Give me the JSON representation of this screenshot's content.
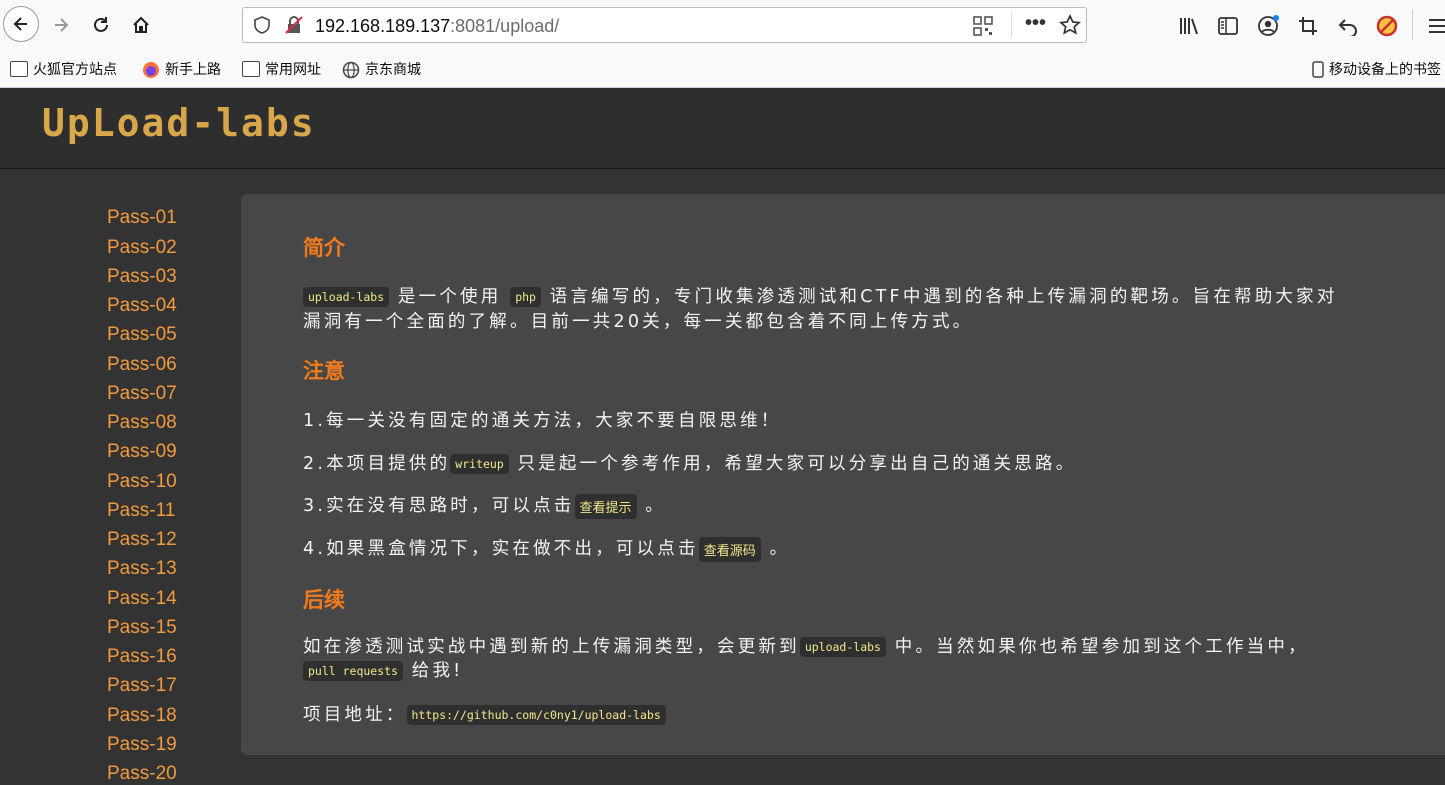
{
  "browser": {
    "url_host": "192.168.189.137",
    "url_rest": ":8081/upload/",
    "bookmarks": [
      "火狐官方站点",
      "新手上路",
      "常用网址",
      "京东商城"
    ],
    "mobile_bookmarks": "移动设备上的书签"
  },
  "site": {
    "logo": "UpLoad-labs"
  },
  "sidebar": {
    "items": [
      "Pass-01",
      "Pass-02",
      "Pass-03",
      "Pass-04",
      "Pass-05",
      "Pass-06",
      "Pass-07",
      "Pass-08",
      "Pass-09",
      "Pass-10",
      "Pass-11",
      "Pass-12",
      "Pass-13",
      "Pass-14",
      "Pass-15",
      "Pass-16",
      "Pass-17",
      "Pass-18",
      "Pass-19",
      "Pass-20"
    ]
  },
  "content": {
    "intro_title": "简介",
    "intro_code1": "upload-labs",
    "intro_text1": "是一个使用",
    "intro_code2": "php",
    "intro_text2": "语言编写的，专门收集渗透测试和CTF中遇到的各种上传漏洞的靶场。旨在帮助大家对",
    "intro_line2": "漏洞有一个全面的了解。目前一共20关，每一关都包含着不同上传方式。",
    "note_title": "注意",
    "note1": "1.每一关没有固定的通关方法，大家不要自限思维！",
    "note2_pre": "2.本项目提供的",
    "note2_code": "writeup",
    "note2_post": "只是起一个参考作用，希望大家可以分享出自己的通关思路。",
    "note3_pre": "3.实在没有思路时，可以点击",
    "note3_link": "查看提示",
    "note3_post": "。",
    "note4_pre": "4.如果黑盒情况下，实在做不出，可以点击",
    "note4_link": "查看源码",
    "note4_post": "。",
    "follow_title": "后续",
    "follow_pre": "如在渗透测试实战中遇到新的上传漏洞类型，会更新到",
    "follow_code": "upload-labs",
    "follow_post": "中。当然如果你也希望参加到这个工作当中，",
    "follow_code2": "pull requests",
    "follow_post2": "给我!",
    "addr_label": "项目地址：",
    "addr_url": "https://github.com/c0ny1/upload-labs"
  }
}
